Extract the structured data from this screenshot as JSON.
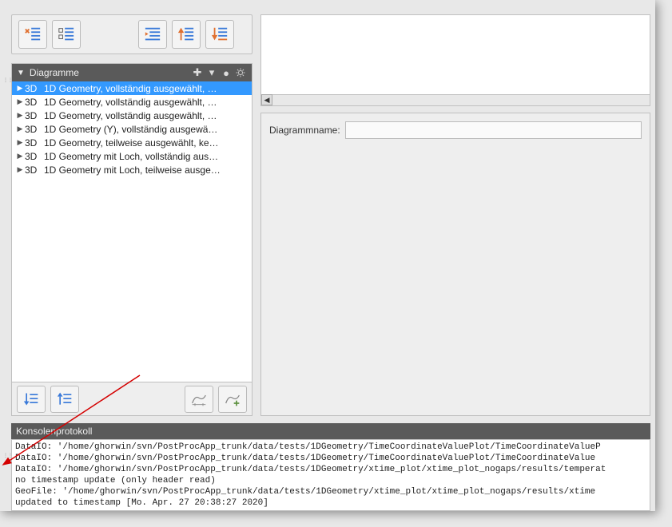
{
  "sidebar": {
    "title": "Diagramme",
    "items": [
      {
        "tag": "3D",
        "label": "1D Geometry, vollständig ausgewählt, …",
        "selected": true
      },
      {
        "tag": "3D",
        "label": "1D Geometry, vollständig ausgewählt, …",
        "selected": false
      },
      {
        "tag": "3D",
        "label": "1D Geometry, vollständig ausgewählt, …",
        "selected": false
      },
      {
        "tag": "3D",
        "label": "1D Geometry (Y), vollständig ausgewä…",
        "selected": false
      },
      {
        "tag": "3D",
        "label": "1D Geometry, teilweise ausgewählt, ke…",
        "selected": false
      },
      {
        "tag": "3D",
        "label": "1D Geometry mit Loch, vollständig aus…",
        "selected": false
      },
      {
        "tag": "3D",
        "label": "1D Geometry mit Loch, teilweise ausge…",
        "selected": false
      }
    ]
  },
  "form": {
    "name_label": "Diagrammname:",
    "name_value": ""
  },
  "console": {
    "title": "Konsolenprotokoll",
    "lines": [
      "DataIO: '/home/ghorwin/svn/PostProcApp_trunk/data/tests/1DGeometry/TimeCoordinateValuePlot/TimeCoordinateValueP",
      "DataIO: '/home/ghorwin/svn/PostProcApp_trunk/data/tests/1DGeometry/TimeCoordinateValuePlot/TimeCoordinateValue",
      "DataIO: '/home/ghorwin/svn/PostProcApp_trunk/data/tests/1DGeometry/xtime_plot/xtime_plot_nogaps/results/temperat",
      "no timestamp update (only header read)",
      "GeoFile: '/home/ghorwin/svn/PostProcApp_trunk/data/tests/1DGeometry/xtime_plot/xtime_plot_nogaps/results/xtime",
      "updated to timestamp [Mo. Apr. 27 20:38:27 2020]"
    ]
  }
}
